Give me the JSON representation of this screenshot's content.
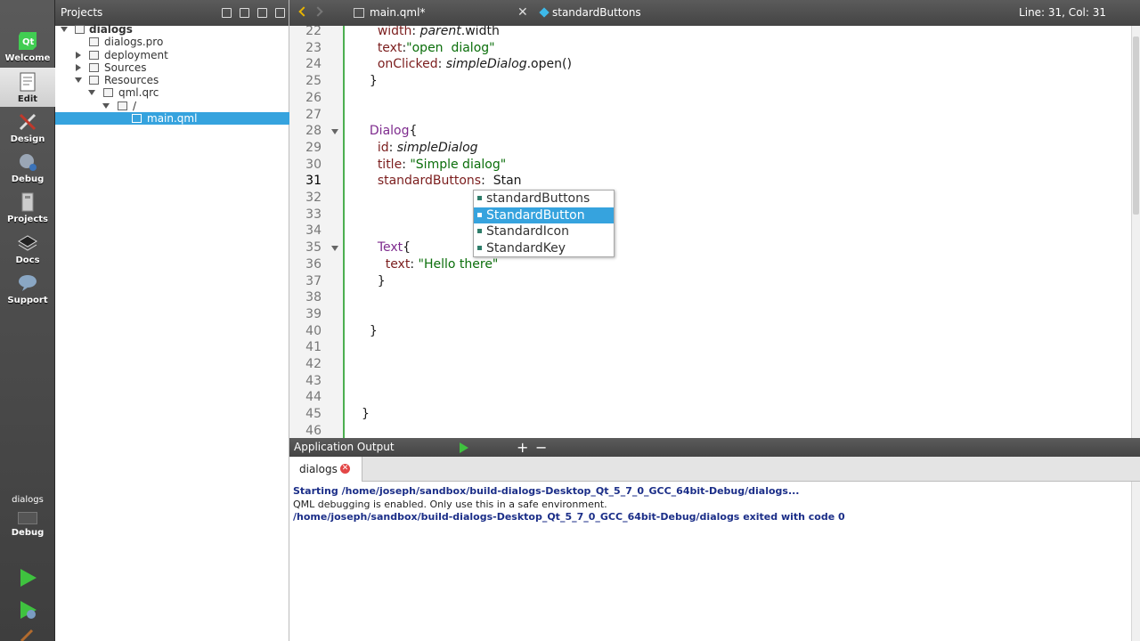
{
  "modes": [
    {
      "label": "Welcome",
      "icon": "qt-logo-icon"
    },
    {
      "label": "Edit",
      "icon": "edit-icon",
      "active": true
    },
    {
      "label": "Design",
      "icon": "design-icon"
    },
    {
      "label": "Debug",
      "icon": "debug-icon"
    },
    {
      "label": "Projects",
      "icon": "projects-icon"
    },
    {
      "label": "Docs",
      "icon": "docs-icon"
    },
    {
      "label": "Support",
      "icon": "support-icon"
    }
  ],
  "kit": {
    "name": "dialogs",
    "mode": "Debug"
  },
  "projects": {
    "title": "Projects",
    "tree": [
      {
        "label": "dialogs"
      },
      {
        "label": "dialogs.pro"
      },
      {
        "label": "deployment"
      },
      {
        "label": "Sources"
      },
      {
        "label": "Resources"
      },
      {
        "label": "qml.qrc"
      },
      {
        "label": "/"
      },
      {
        "label": "main.qml"
      }
    ]
  },
  "editor_toolbar": {
    "file": "main.qml*",
    "symbol": "standardButtons",
    "position": "Line: 31, Col: 31"
  },
  "editor": {
    "current_line": 31,
    "lines": [
      {
        "n": "22",
        "segs": [
          {
            "t": "    "
          },
          {
            "t": "width",
            "c": "prop"
          },
          {
            "t": ": "
          },
          {
            "t": "parent",
            "c": "it"
          },
          {
            "t": ".width"
          }
        ]
      },
      {
        "n": "23",
        "segs": [
          {
            "t": "    "
          },
          {
            "t": "text",
            "c": "prop"
          },
          {
            "t": ":"
          },
          {
            "t": "\"open  dialog\"",
            "c": "str"
          }
        ]
      },
      {
        "n": "24",
        "segs": [
          {
            "t": "    "
          },
          {
            "t": "onClicked",
            "c": "prop"
          },
          {
            "t": ": "
          },
          {
            "t": "simpleDialog",
            "c": "it"
          },
          {
            "t": ".open()"
          }
        ]
      },
      {
        "n": "25",
        "segs": [
          {
            "t": "  }"
          }
        ]
      },
      {
        "n": "26",
        "segs": []
      },
      {
        "n": "27",
        "segs": []
      },
      {
        "n": "28",
        "fold": true,
        "segs": [
          {
            "t": "  "
          },
          {
            "t": "Dialog",
            "c": "kw"
          },
          {
            "t": "{"
          }
        ]
      },
      {
        "n": "29",
        "segs": [
          {
            "t": "    "
          },
          {
            "t": "id",
            "c": "prop"
          },
          {
            "t": ": "
          },
          {
            "t": "simpleDialog",
            "c": "it"
          }
        ]
      },
      {
        "n": "30",
        "segs": [
          {
            "t": "    "
          },
          {
            "t": "title",
            "c": "prop"
          },
          {
            "t": ": "
          },
          {
            "t": "\"Simple dialog\"",
            "c": "str"
          }
        ]
      },
      {
        "n": "31",
        "segs": [
          {
            "t": "    "
          },
          {
            "t": "standardButtons",
            "c": "prop"
          },
          {
            "t": ":  Stan"
          }
        ]
      },
      {
        "n": "32",
        "segs": []
      },
      {
        "n": "33",
        "segs": []
      },
      {
        "n": "34",
        "segs": []
      },
      {
        "n": "35",
        "fold": true,
        "segs": [
          {
            "t": "    "
          },
          {
            "t": "Text",
            "c": "kw"
          },
          {
            "t": "{"
          }
        ]
      },
      {
        "n": "36",
        "segs": [
          {
            "t": "      "
          },
          {
            "t": "text",
            "c": "prop"
          },
          {
            "t": ": "
          },
          {
            "t": "\"Hello there\"",
            "c": "str"
          }
        ]
      },
      {
        "n": "37",
        "segs": [
          {
            "t": "    }"
          }
        ]
      },
      {
        "n": "38",
        "segs": []
      },
      {
        "n": "39",
        "segs": []
      },
      {
        "n": "40",
        "segs": [
          {
            "t": "  }"
          }
        ]
      },
      {
        "n": "41",
        "segs": []
      },
      {
        "n": "42",
        "segs": []
      },
      {
        "n": "43",
        "segs": []
      },
      {
        "n": "44",
        "segs": []
      },
      {
        "n": "45",
        "segs": [
          {
            "t": "}"
          }
        ]
      },
      {
        "n": "46",
        "segs": []
      }
    ]
  },
  "completion": [
    "standardButtons",
    "StandardButton",
    "StandardIcon",
    "StandardKey"
  ],
  "output": {
    "title": "Application Output",
    "tab": "dialogs",
    "lines": [
      "Starting /home/joseph/sandbox/build-dialogs-Desktop_Qt_5_7_0_GCC_64bit-Debug/dialogs...",
      "QML debugging is enabled. Only use this in a safe environment.",
      "/home/joseph/sandbox/build-dialogs-Desktop_Qt_5_7_0_GCC_64bit-Debug/dialogs exited with code 0"
    ]
  }
}
